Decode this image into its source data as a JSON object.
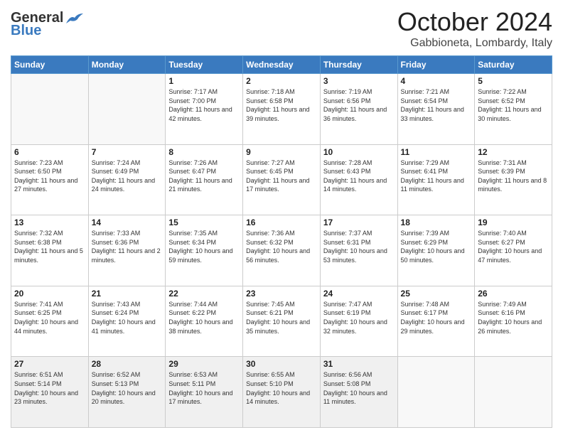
{
  "header": {
    "logo_line1": "General",
    "logo_line2": "Blue",
    "month": "October 2024",
    "location": "Gabbioneta, Lombardy, Italy"
  },
  "days_of_week": [
    "Sunday",
    "Monday",
    "Tuesday",
    "Wednesday",
    "Thursday",
    "Friday",
    "Saturday"
  ],
  "weeks": [
    [
      {
        "day": "",
        "info": ""
      },
      {
        "day": "",
        "info": ""
      },
      {
        "day": "1",
        "info": "Sunrise: 7:17 AM\nSunset: 7:00 PM\nDaylight: 11 hours and 42 minutes."
      },
      {
        "day": "2",
        "info": "Sunrise: 7:18 AM\nSunset: 6:58 PM\nDaylight: 11 hours and 39 minutes."
      },
      {
        "day": "3",
        "info": "Sunrise: 7:19 AM\nSunset: 6:56 PM\nDaylight: 11 hours and 36 minutes."
      },
      {
        "day": "4",
        "info": "Sunrise: 7:21 AM\nSunset: 6:54 PM\nDaylight: 11 hours and 33 minutes."
      },
      {
        "day": "5",
        "info": "Sunrise: 7:22 AM\nSunset: 6:52 PM\nDaylight: 11 hours and 30 minutes."
      }
    ],
    [
      {
        "day": "6",
        "info": "Sunrise: 7:23 AM\nSunset: 6:50 PM\nDaylight: 11 hours and 27 minutes."
      },
      {
        "day": "7",
        "info": "Sunrise: 7:24 AM\nSunset: 6:49 PM\nDaylight: 11 hours and 24 minutes."
      },
      {
        "day": "8",
        "info": "Sunrise: 7:26 AM\nSunset: 6:47 PM\nDaylight: 11 hours and 21 minutes."
      },
      {
        "day": "9",
        "info": "Sunrise: 7:27 AM\nSunset: 6:45 PM\nDaylight: 11 hours and 17 minutes."
      },
      {
        "day": "10",
        "info": "Sunrise: 7:28 AM\nSunset: 6:43 PM\nDaylight: 11 hours and 14 minutes."
      },
      {
        "day": "11",
        "info": "Sunrise: 7:29 AM\nSunset: 6:41 PM\nDaylight: 11 hours and 11 minutes."
      },
      {
        "day": "12",
        "info": "Sunrise: 7:31 AM\nSunset: 6:39 PM\nDaylight: 11 hours and 8 minutes."
      }
    ],
    [
      {
        "day": "13",
        "info": "Sunrise: 7:32 AM\nSunset: 6:38 PM\nDaylight: 11 hours and 5 minutes."
      },
      {
        "day": "14",
        "info": "Sunrise: 7:33 AM\nSunset: 6:36 PM\nDaylight: 11 hours and 2 minutes."
      },
      {
        "day": "15",
        "info": "Sunrise: 7:35 AM\nSunset: 6:34 PM\nDaylight: 10 hours and 59 minutes."
      },
      {
        "day": "16",
        "info": "Sunrise: 7:36 AM\nSunset: 6:32 PM\nDaylight: 10 hours and 56 minutes."
      },
      {
        "day": "17",
        "info": "Sunrise: 7:37 AM\nSunset: 6:31 PM\nDaylight: 10 hours and 53 minutes."
      },
      {
        "day": "18",
        "info": "Sunrise: 7:39 AM\nSunset: 6:29 PM\nDaylight: 10 hours and 50 minutes."
      },
      {
        "day": "19",
        "info": "Sunrise: 7:40 AM\nSunset: 6:27 PM\nDaylight: 10 hours and 47 minutes."
      }
    ],
    [
      {
        "day": "20",
        "info": "Sunrise: 7:41 AM\nSunset: 6:25 PM\nDaylight: 10 hours and 44 minutes."
      },
      {
        "day": "21",
        "info": "Sunrise: 7:43 AM\nSunset: 6:24 PM\nDaylight: 10 hours and 41 minutes."
      },
      {
        "day": "22",
        "info": "Sunrise: 7:44 AM\nSunset: 6:22 PM\nDaylight: 10 hours and 38 minutes."
      },
      {
        "day": "23",
        "info": "Sunrise: 7:45 AM\nSunset: 6:21 PM\nDaylight: 10 hours and 35 minutes."
      },
      {
        "day": "24",
        "info": "Sunrise: 7:47 AM\nSunset: 6:19 PM\nDaylight: 10 hours and 32 minutes."
      },
      {
        "day": "25",
        "info": "Sunrise: 7:48 AM\nSunset: 6:17 PM\nDaylight: 10 hours and 29 minutes."
      },
      {
        "day": "26",
        "info": "Sunrise: 7:49 AM\nSunset: 6:16 PM\nDaylight: 10 hours and 26 minutes."
      }
    ],
    [
      {
        "day": "27",
        "info": "Sunrise: 6:51 AM\nSunset: 5:14 PM\nDaylight: 10 hours and 23 minutes."
      },
      {
        "day": "28",
        "info": "Sunrise: 6:52 AM\nSunset: 5:13 PM\nDaylight: 10 hours and 20 minutes."
      },
      {
        "day": "29",
        "info": "Sunrise: 6:53 AM\nSunset: 5:11 PM\nDaylight: 10 hours and 17 minutes."
      },
      {
        "day": "30",
        "info": "Sunrise: 6:55 AM\nSunset: 5:10 PM\nDaylight: 10 hours and 14 minutes."
      },
      {
        "day": "31",
        "info": "Sunrise: 6:56 AM\nSunset: 5:08 PM\nDaylight: 10 hours and 11 minutes."
      },
      {
        "day": "",
        "info": ""
      },
      {
        "day": "",
        "info": ""
      }
    ]
  ]
}
